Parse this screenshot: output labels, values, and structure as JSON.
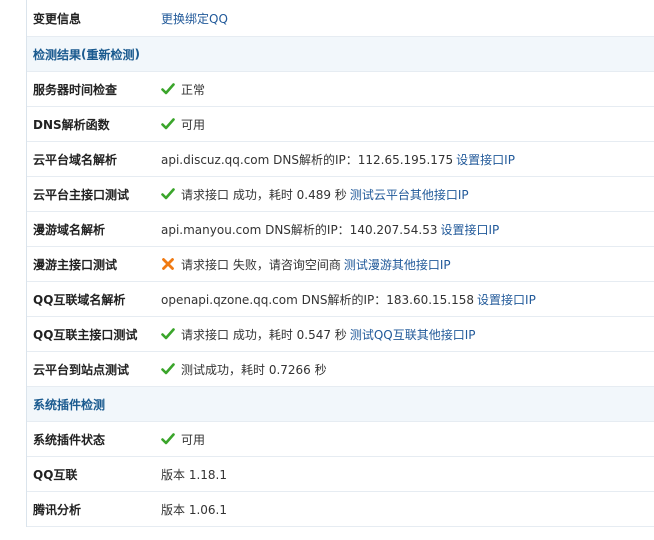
{
  "change_info": {
    "label": "变更信息",
    "link": "更换绑定QQ"
  },
  "results_header": {
    "title": "检测结果",
    "paren_open": "(",
    "recheck_link": "重新检测",
    "paren_close": ")"
  },
  "rows": [
    {
      "label": "服务器时间检查",
      "status": "ok",
      "text": "正常"
    },
    {
      "label": "DNS解析函数",
      "status": "ok",
      "text": "可用"
    },
    {
      "label": "云平台域名解析",
      "status": "none",
      "text": "api.discuz.qq.com DNS解析的IP：112.65.195.175",
      "link": "设置接口IP"
    },
    {
      "label": "云平台主接口测试",
      "status": "ok",
      "text": "请求接口 成功，耗时 0.489 秒",
      "link": "测试云平台其他接口IP"
    },
    {
      "label": "漫游域名解析",
      "status": "none",
      "text": "api.manyou.com DNS解析的IP：140.207.54.53",
      "link": "设置接口IP"
    },
    {
      "label": "漫游主接口测试",
      "status": "fail",
      "text": "请求接口 失败，请咨询空间商",
      "link": "测试漫游其他接口IP"
    },
    {
      "label": "QQ互联域名解析",
      "status": "none",
      "text": "openapi.qzone.qq.com DNS解析的IP：183.60.15.158",
      "link": "设置接口IP"
    },
    {
      "label": "QQ互联主接口测试",
      "status": "ok",
      "text": "请求接口 成功，耗时 0.547 秒",
      "link": "测试QQ互联其他接口IP"
    },
    {
      "label": "云平台到站点测试",
      "status": "ok",
      "text": "测试成功，耗时 0.7266 秒"
    }
  ],
  "plugin_header": {
    "title": "系统插件检测"
  },
  "plugin_rows": [
    {
      "label": "系统插件状态",
      "status": "ok",
      "text": "可用"
    },
    {
      "label": "QQ互联",
      "status": "none",
      "text": "版本 1.18.1"
    },
    {
      "label": "腾讯分析",
      "status": "none",
      "text": "版本 1.06.1"
    }
  ],
  "colors": {
    "ok": "#3aa52b",
    "fail": "#f07a12",
    "link": "#225a9a",
    "section_bg": "#f2f7fb"
  },
  "icons": {
    "ok": "check-icon",
    "fail": "cross-icon"
  }
}
